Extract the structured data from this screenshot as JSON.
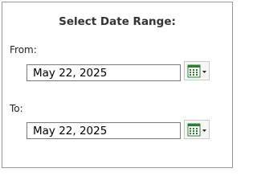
{
  "dialog": {
    "title": "Select Date Range:",
    "from": {
      "label": "From:",
      "value": "May 22, 2025"
    },
    "to": {
      "label": "To:",
      "value": "May 22, 2025"
    }
  },
  "icons": {
    "calendar": "calendar-dropdown-icon"
  },
  "colors": {
    "calendar_grid": "#2e7d32",
    "border": "#7a7a7a"
  }
}
